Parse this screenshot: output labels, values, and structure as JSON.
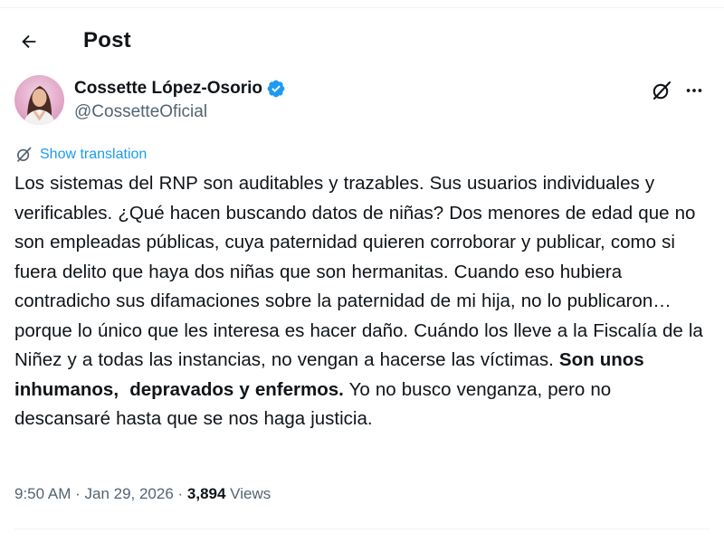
{
  "header": {
    "title": "Post"
  },
  "author": {
    "name": "Cossette López-Osorio",
    "handle": "@CossetteOficial",
    "verified": true
  },
  "icons": {
    "back": "arrow-left-icon",
    "verified": "verified-badge-icon",
    "grok": "grok-icon",
    "more": "more-horizontal-icon",
    "translation": "translate-icon"
  },
  "translation": {
    "label": "Show translation"
  },
  "post": {
    "text_regular_1": "Los sistemas del RNP son auditables y trazables. Sus usuarios individuales y verificables. ¿Qué hacen buscando datos de niñas? Dos menores de edad que no son empleadas públicas, cuya paternidad quieren corroborar y publicar, como si fuera delito que haya dos niñas que son hermanitas. Cuando eso hubiera contradicho sus difamaciones sobre la paternidad de mi hija, no lo publicaron… porque lo único que les interesa es hacer daño. Cuándo los lleve a la Fiscalía de la Niñez y a todas las instancias, no vengan a hacerse las víctimas. ",
    "text_bold": "Son unos inhumanos,  depravados y enfermos.",
    "text_regular_2": " Yo no busco venganza, pero no descansaré hasta que se nos haga justicia."
  },
  "meta": {
    "time": "9:50 AM",
    "separator": " · ",
    "date": "Jan 29, 2026",
    "views_count": "3,894",
    "views_label": " Views"
  },
  "colors": {
    "accent": "#1d9bf0",
    "text_primary": "#0f1419",
    "text_secondary": "#536471",
    "divider": "#eff3f4"
  }
}
